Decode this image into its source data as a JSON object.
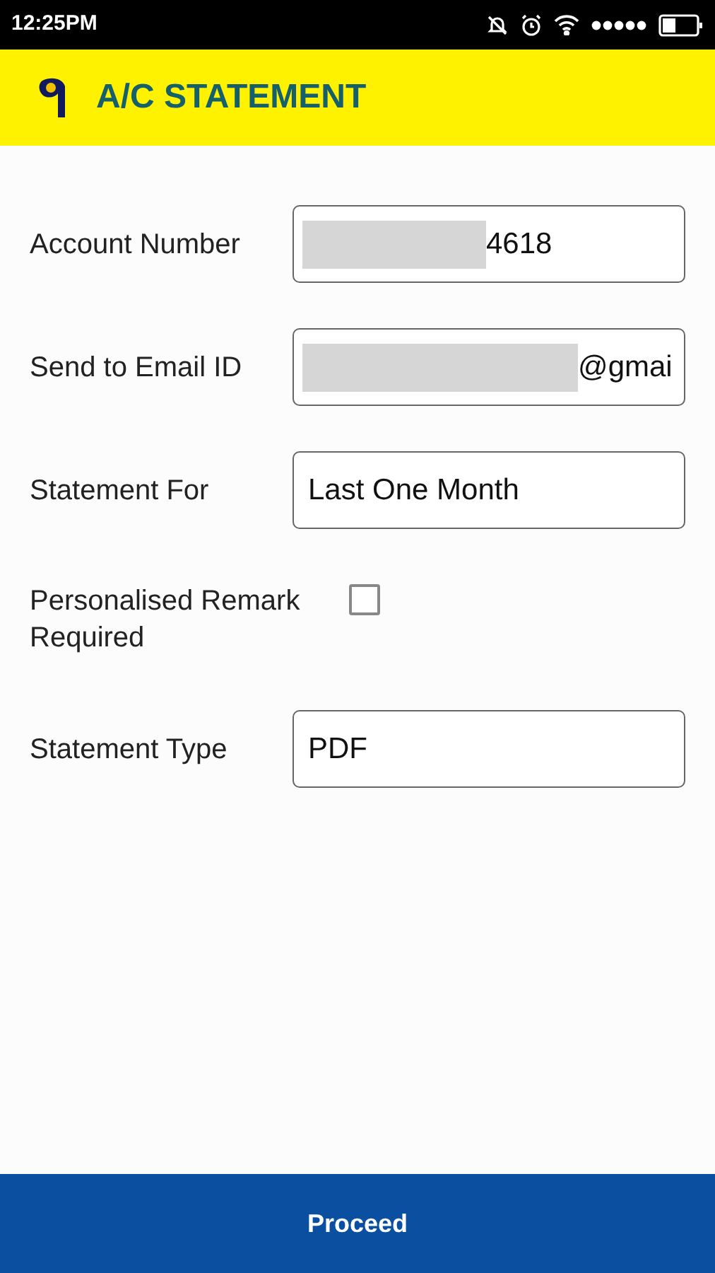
{
  "status_bar": {
    "time": "12:25PM"
  },
  "header": {
    "title": "A/C STATEMENT"
  },
  "form": [
    {
      "kind": "field",
      "label": "Account Number",
      "value": "4618",
      "masked": true
    },
    {
      "kind": "field",
      "label": "Send to Email ID",
      "value": "@gmai",
      "masked": true
    },
    {
      "kind": "field",
      "label": "Statement For",
      "value": "Last One Month",
      "masked": false
    },
    {
      "kind": "checkbox",
      "label": "Personalised Remark Required",
      "checked": false
    },
    {
      "kind": "field",
      "label": "Statement Type",
      "value": "PDF",
      "masked": false
    }
  ],
  "button": {
    "label": "Proceed"
  }
}
